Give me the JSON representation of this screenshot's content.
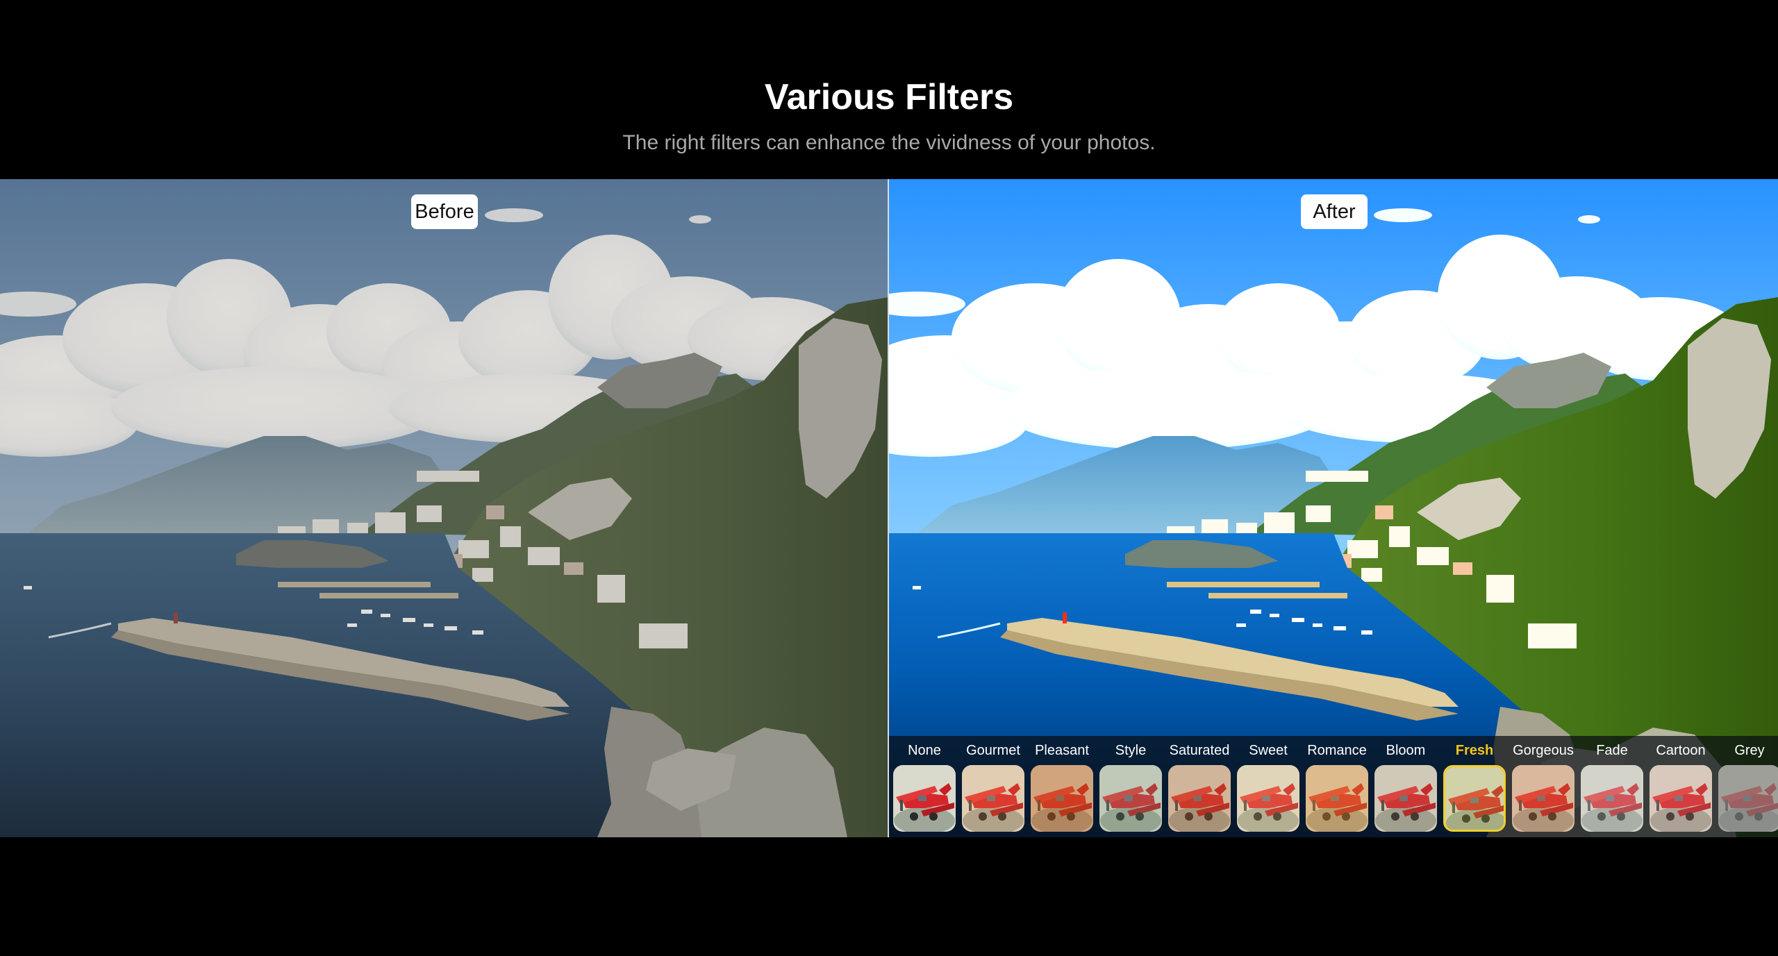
{
  "header": {
    "title": "Various Filters",
    "subtitle": "The right filters can enhance the vividness of your photos."
  },
  "comparison": {
    "before_label": "Before",
    "after_label": "After"
  },
  "filters": {
    "selected": "Fresh",
    "items": [
      {
        "label": "None",
        "tint": "rgba(0,0,0,0)"
      },
      {
        "label": "Gourmet",
        "tint": "rgba(255,150,60,0.18)"
      },
      {
        "label": "Pleasant",
        "tint": "rgba(200,90,20,0.42)"
      },
      {
        "label": "Style",
        "tint": "rgba(120,150,120,0.25)"
      },
      {
        "label": "Saturated",
        "tint": "rgba(190,100,40,0.30)"
      },
      {
        "label": "Sweet",
        "tint": "rgba(255,200,120,0.22)"
      },
      {
        "label": "Romance",
        "tint": "rgba(230,140,40,0.38)"
      },
      {
        "label": "Bloom",
        "tint": "rgba(170,130,90,0.18)"
      },
      {
        "label": "Fresh",
        "tint": "rgba(190,190,60,0.25)"
      },
      {
        "label": "Gorgeous",
        "tint": "rgba(220,110,50,0.30)"
      },
      {
        "label": "Fade",
        "tint": "rgba(200,200,200,0.30)"
      },
      {
        "label": "Cartoon",
        "tint": "rgba(220,140,130,0.22)"
      },
      {
        "label": "Grey",
        "tint": "rgba(128,128,128,0.65)"
      }
    ]
  },
  "colors": {
    "background": "#000000",
    "selected_filter": "#f5c518",
    "subtitle": "#a9a9a9"
  }
}
